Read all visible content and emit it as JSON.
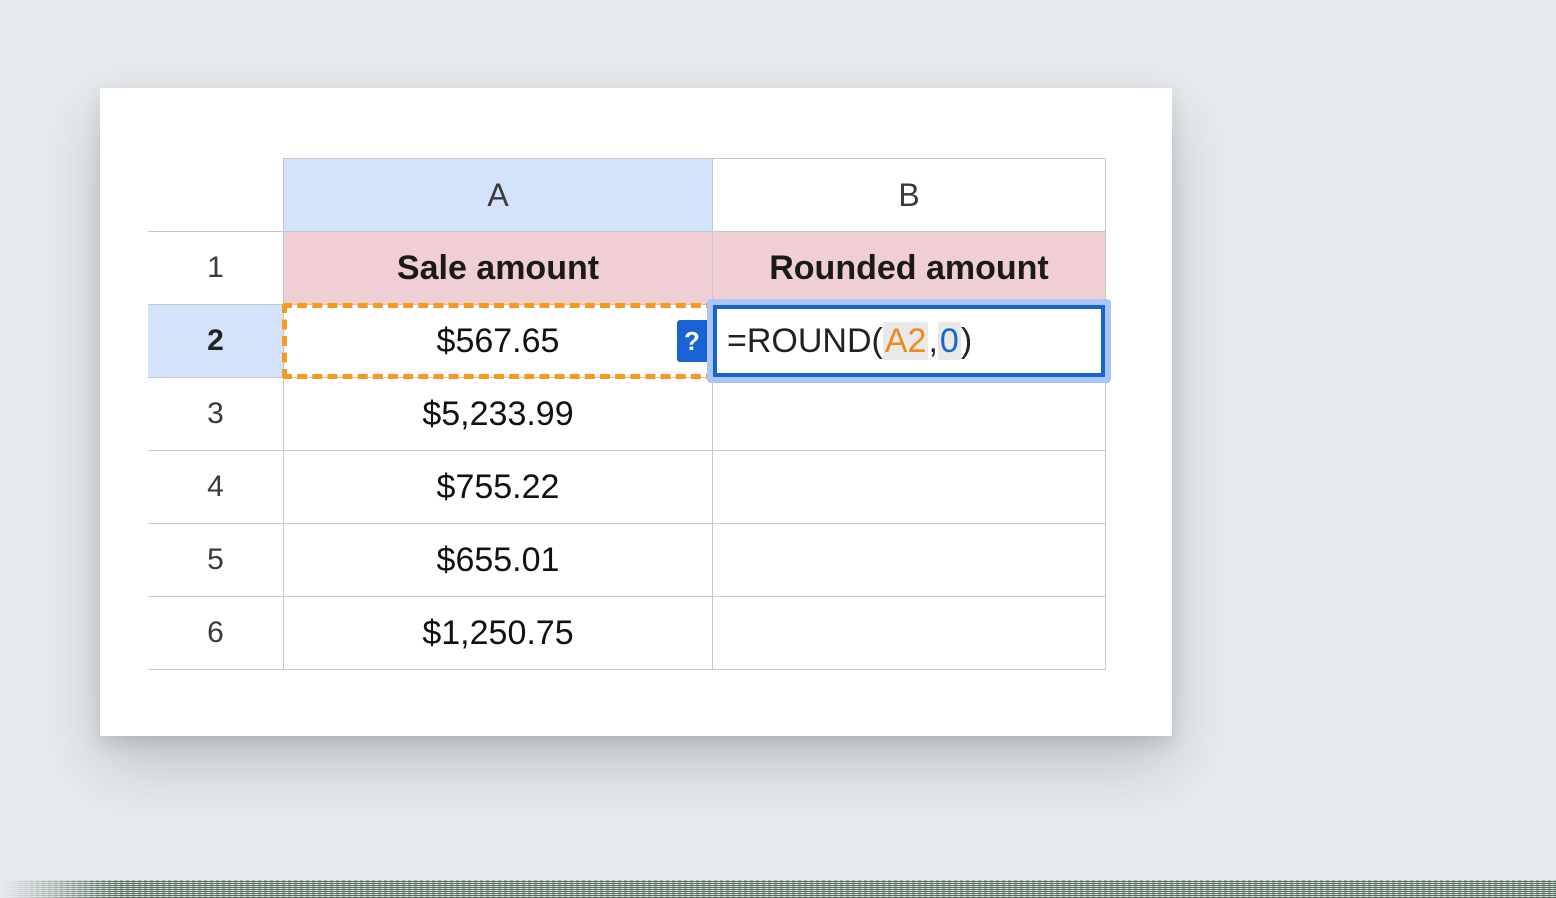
{
  "columns": {
    "A": "A",
    "B": "B"
  },
  "headers": {
    "A": "Sale amount",
    "B": "Rounded amount"
  },
  "rows": [
    {
      "n": "1"
    },
    {
      "n": "2",
      "A": "$567.65"
    },
    {
      "n": "3",
      "A": "$5,233.99"
    },
    {
      "n": "4",
      "A": "$755.22"
    },
    {
      "n": "5",
      "A": "$655.01"
    },
    {
      "n": "6",
      "A": "$1,250.75"
    }
  ],
  "active_cell": "B2",
  "referenced_cell": "A2",
  "help_badge": "?",
  "formula": {
    "raw": "=ROUND(A2,0)",
    "tokens": {
      "eq": "=",
      "fn": "ROUND",
      "open": "(",
      "ref": "A2",
      "sep": ",",
      "arg": "0",
      "close": ")"
    }
  }
}
